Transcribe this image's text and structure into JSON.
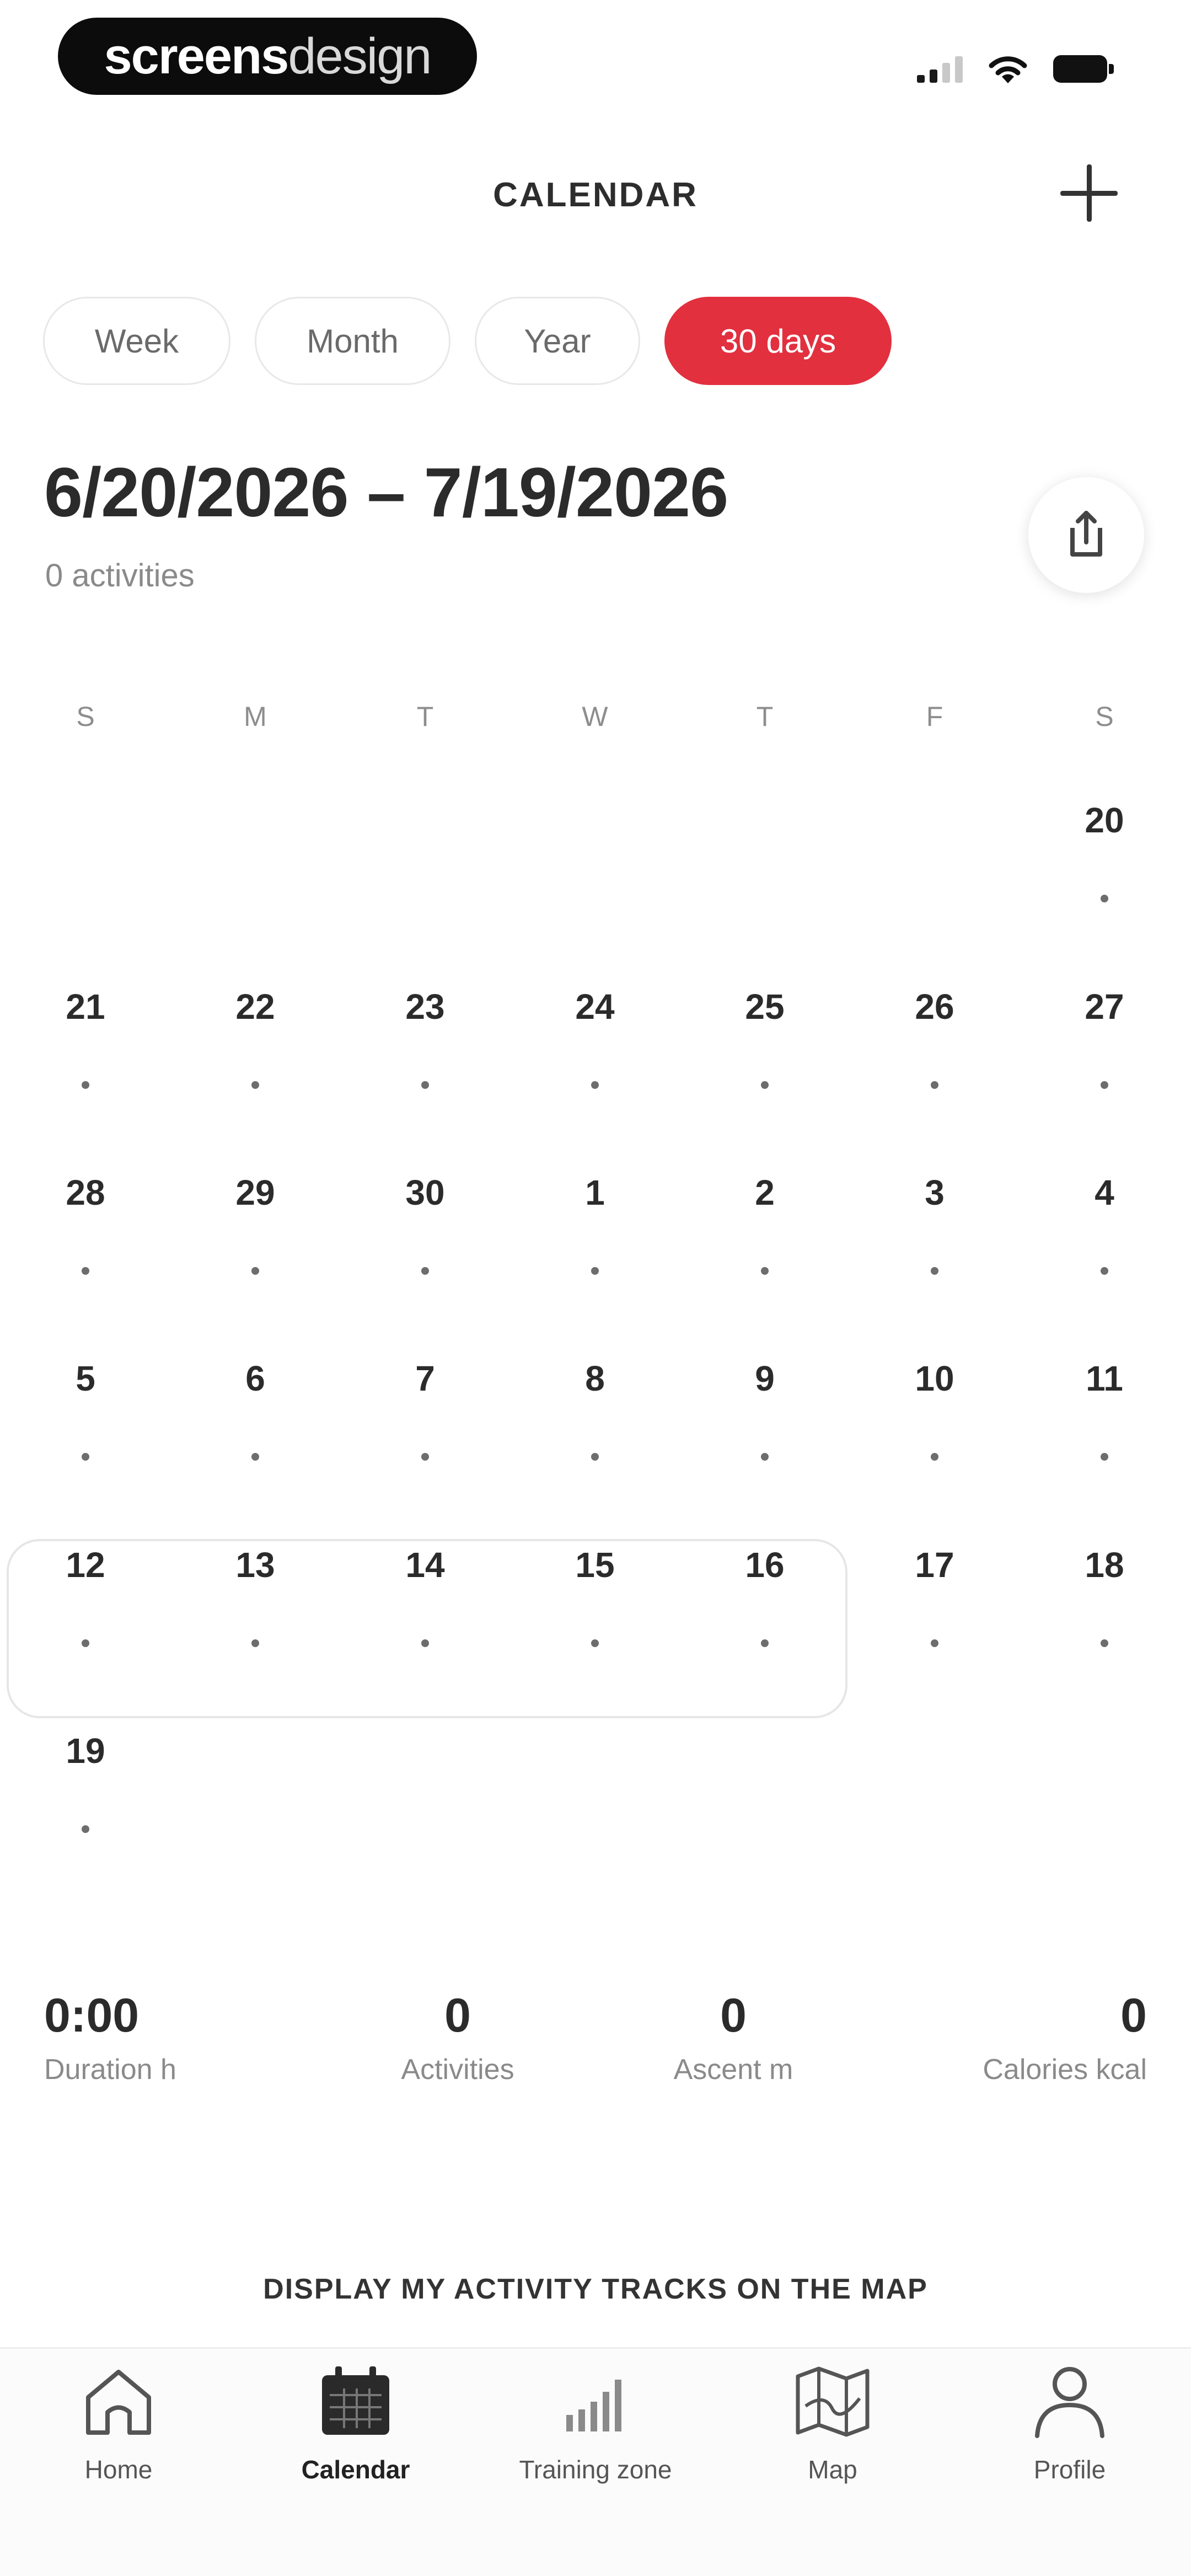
{
  "status_bar": {
    "brand_part1": "screens",
    "brand_part2": "design"
  },
  "header": {
    "title": "CALENDAR"
  },
  "filters": [
    {
      "label": "Week",
      "active": false
    },
    {
      "label": "Month",
      "active": false
    },
    {
      "label": "Year",
      "active": false
    },
    {
      "label": "30 days",
      "active": true
    }
  ],
  "range": {
    "label": "6/20/2026 – 7/19/2026",
    "count": "0 activities"
  },
  "calendar": {
    "weekdays": [
      "S",
      "M",
      "T",
      "W",
      "T",
      "F",
      "S"
    ],
    "weeks": [
      [
        "",
        "",
        "",
        "",
        "",
        "",
        "20"
      ],
      [
        "21",
        "22",
        "23",
        "24",
        "25",
        "26",
        "27"
      ],
      [
        "28",
        "29",
        "30",
        "1",
        "2",
        "3",
        "4"
      ],
      [
        "5",
        "6",
        "7",
        "8",
        "9",
        "10",
        "11"
      ],
      [
        "12",
        "13",
        "14",
        "15",
        "16",
        "17",
        "18"
      ],
      [
        "19",
        "",
        "",
        "",
        "",
        "",
        ""
      ]
    ]
  },
  "stats": [
    {
      "value": "0:00",
      "label": "Duration h"
    },
    {
      "value": "0",
      "label": "Activities"
    },
    {
      "value": "0",
      "label": "Ascent m"
    },
    {
      "value": "0",
      "label": "Calories kcal"
    }
  ],
  "map_link": "DISPLAY MY ACTIVITY TRACKS ON THE MAP",
  "tabbar": [
    {
      "label": "Home",
      "icon": "home-icon",
      "active": false
    },
    {
      "label": "Calendar",
      "icon": "calendar-icon",
      "active": true
    },
    {
      "label": "Training zone",
      "icon": "bar-chart-icon",
      "active": false
    },
    {
      "label": "Map",
      "icon": "map-icon",
      "active": false
    },
    {
      "label": "Profile",
      "icon": "person-icon",
      "active": false
    }
  ],
  "colors": {
    "accent": "#e2303f",
    "text": "#2b2b2b",
    "muted": "#8a8a8a"
  }
}
